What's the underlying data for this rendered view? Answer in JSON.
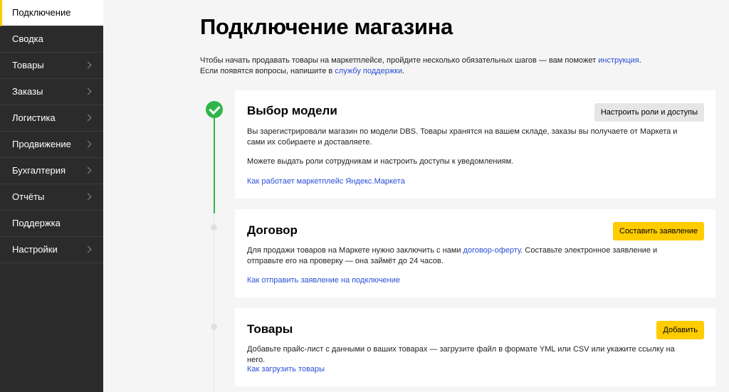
{
  "sidebar": {
    "items": [
      {
        "label": "Подключение",
        "active": true,
        "has_chevron": false
      },
      {
        "label": "Сводка",
        "active": false,
        "has_chevron": false
      },
      {
        "label": "Товары",
        "active": false,
        "has_chevron": true
      },
      {
        "label": "Заказы",
        "active": false,
        "has_chevron": true
      },
      {
        "label": "Логистика",
        "active": false,
        "has_chevron": true
      },
      {
        "label": "Продвижение",
        "active": false,
        "has_chevron": true
      },
      {
        "label": "Бухгалтерия",
        "active": false,
        "has_chevron": true
      },
      {
        "label": "Отчёты",
        "active": false,
        "has_chevron": true
      },
      {
        "label": "Поддержка",
        "active": false,
        "has_chevron": false
      },
      {
        "label": "Настройки",
        "active": false,
        "has_chevron": true
      }
    ]
  },
  "page": {
    "title": "Подключение магазина",
    "intro_line1_prefix": "Чтобы начать продавать товары на маркетплейсе, пройдите несколько обязательных шагов — вам поможет ",
    "intro_line1_link": "инструкция",
    "intro_line1_suffix": ".",
    "intro_line2_prefix": "Если появятся вопросы, напишите в ",
    "intro_line2_link": "службу поддержки",
    "intro_line2_suffix": "."
  },
  "steps": {
    "model": {
      "title": "Выбор модели",
      "status": "done",
      "button": "Настроить роли и доступы",
      "text1": "Вы зарегистрировали магазин по модели DBS. Товары хранятся на вашем складе, заказы вы получаете от Маркета и сами их собираете и доставляете.",
      "text2": "Можете выдать роли сотрудникам и настроить доступы к уведомлениям.",
      "link": "Как работает маркетплейс Яндекс.Маркета"
    },
    "contract": {
      "title": "Договор",
      "status": "pending",
      "button": "Составить заявление",
      "text_prefix": "Для продажи товаров на Маркете нужно заключить с нами ",
      "text_link": "договор-оферту",
      "text_suffix": ". Составьте электронное заявление и отправьте его на проверку — она займёт до 24 часов.",
      "link": "Как отправить заявление на подключение"
    },
    "goods": {
      "title": "Товары",
      "status": "pending",
      "button": "Добавить",
      "text": "Добавьте прайс-лист с данными о ваших товарах — загрузите файл в формате YML или CSV или укажите ссылку на него.",
      "link": "Как загрузить товары"
    }
  },
  "colors": {
    "sidebar_bg": "#2b2b2b",
    "accent_yellow": "#ffcc00",
    "success_green": "#2fb54a",
    "link_blue": "#2a4fd7"
  }
}
